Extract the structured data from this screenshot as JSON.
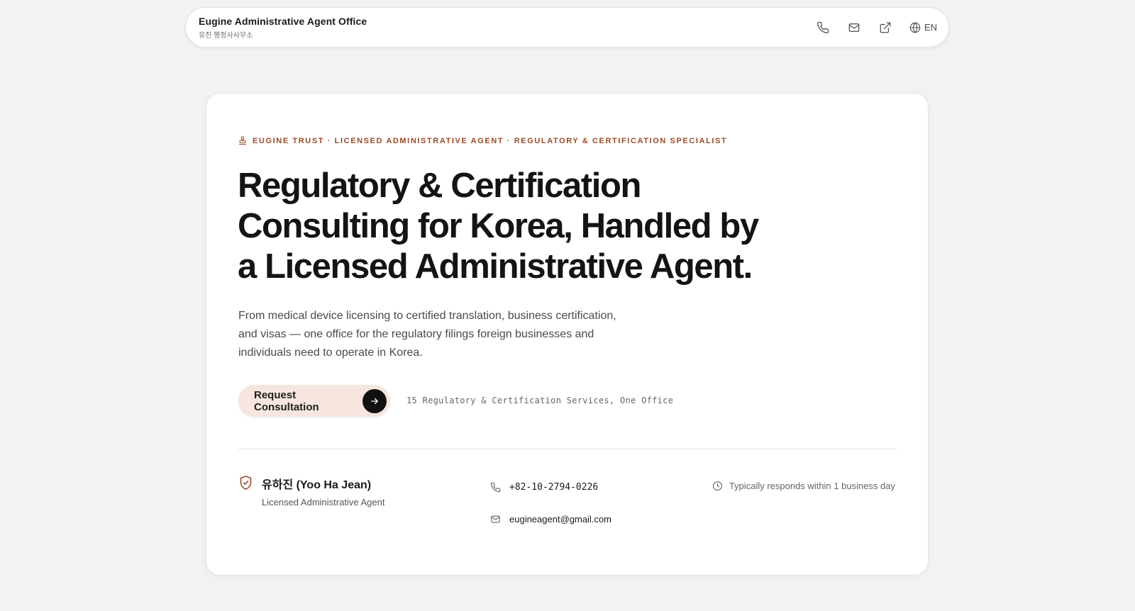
{
  "navbar": {
    "title": "Eugine Administrative Agent Office",
    "subtitle": "유진 행정사사무소",
    "icons": [
      "phone-icon",
      "mail-icon",
      "external-link-icon",
      "globe-icon"
    ],
    "language": "EN"
  },
  "hero": {
    "eyebrow": "EUGINE TRUST · LICENSED ADMINISTRATIVE AGENT · REGULATORY & CERTIFICATION SPECIALIST",
    "eyebrow_icon": "stamp-icon",
    "headline": "Regulatory & Certification Consulting for Korea, Handled by a Licensed Administrative Agent.",
    "lede": "From medical device licensing to certified translation, business certification, and visas — one office for the regulatory filings foreign businesses and individuals need to operate in Korea.",
    "cta_label": "Request Consultation",
    "cta_note": "15 Regulatory & Certification Services, One Office"
  },
  "agent": {
    "icon": "shield-check-icon",
    "name": "유하진 (Yoo Ha Jean)",
    "role": "Licensed Administrative Agent"
  },
  "contact": {
    "phone": "+82-10-2794-0226",
    "email": "eugineagent@gmail.com",
    "response_note": "Typically responds within 1 business day"
  },
  "colors": {
    "accent": "#9c4a25",
    "cta_bg": "#f7e6df",
    "page_bg": "#f2f2f2"
  }
}
